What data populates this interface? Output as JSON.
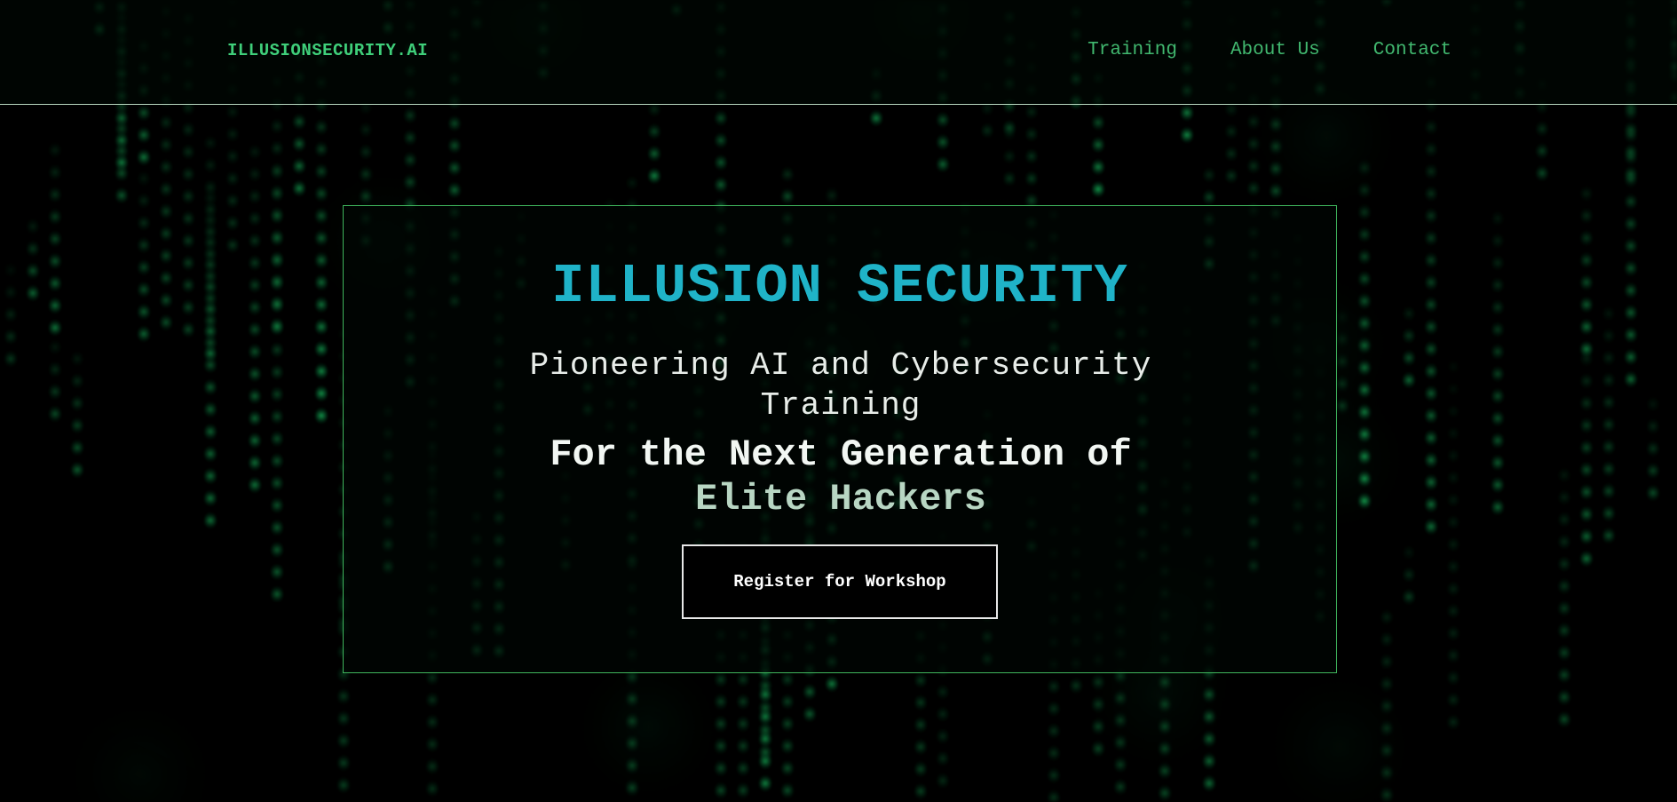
{
  "header": {
    "brand": "ILLUSIONSECURITY.AI",
    "nav": [
      {
        "label": "Training"
      },
      {
        "label": "About Us"
      },
      {
        "label": "Contact"
      }
    ]
  },
  "hero": {
    "title": "ILLUSION SECURITY",
    "subtitle": "Pioneering AI and Cybersecurity Training",
    "tagline_part1": "For the Next Generation of",
    "tagline_part2": "Elite Hackers",
    "cta_label": "Register for Workshop"
  },
  "background": {
    "effect": "matrix-digital-rain",
    "rain_color": "#00ff66"
  },
  "colors": {
    "brand": "#3fcf7a",
    "nav_link": "#41b86f",
    "title": "#1fb3c8",
    "card_border": "#3fb55c",
    "background": "#000000"
  }
}
